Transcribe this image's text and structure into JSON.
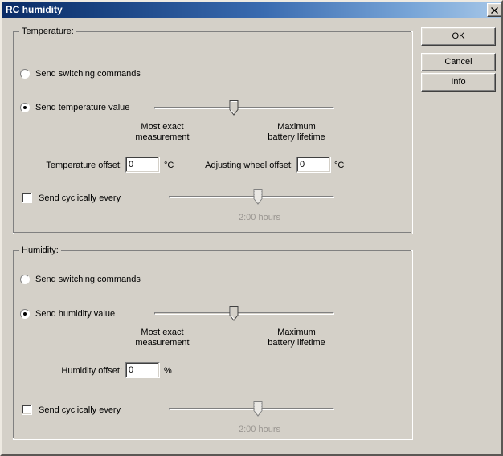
{
  "window": {
    "title": "RC humidity",
    "close_label": "✕"
  },
  "buttons": {
    "ok": "OK",
    "cancel": "Cancel",
    "info": "Info"
  },
  "temperature": {
    "group_label": "Temperature:",
    "radio_switching": "Send switching commands",
    "radio_value": "Send temperature value",
    "slider_left_line1": "Most exact",
    "slider_left_line2": "measurement",
    "slider_right_line1": "Maximum",
    "slider_right_line2": "battery lifetime",
    "offset_label": "Temperature offset:",
    "offset_value": "0",
    "offset_unit": "°C",
    "wheel_label": "Adjusting wheel offset:",
    "wheel_value": "0",
    "wheel_unit": "°C",
    "cyclic_label": "Send cyclically every",
    "cyclic_value": "2:00 hours"
  },
  "humidity": {
    "group_label": "Humidity:",
    "radio_switching": "Send switching commands",
    "radio_value": "Send humidity value",
    "slider_left_line1": "Most exact",
    "slider_left_line2": "measurement",
    "slider_right_line1": "Maximum",
    "slider_right_line2": "battery lifetime",
    "offset_label": "Humidity offset:",
    "offset_value": "0",
    "offset_unit": "%",
    "cyclic_label": "Send cyclically every",
    "cyclic_value": "2:00 hours"
  }
}
